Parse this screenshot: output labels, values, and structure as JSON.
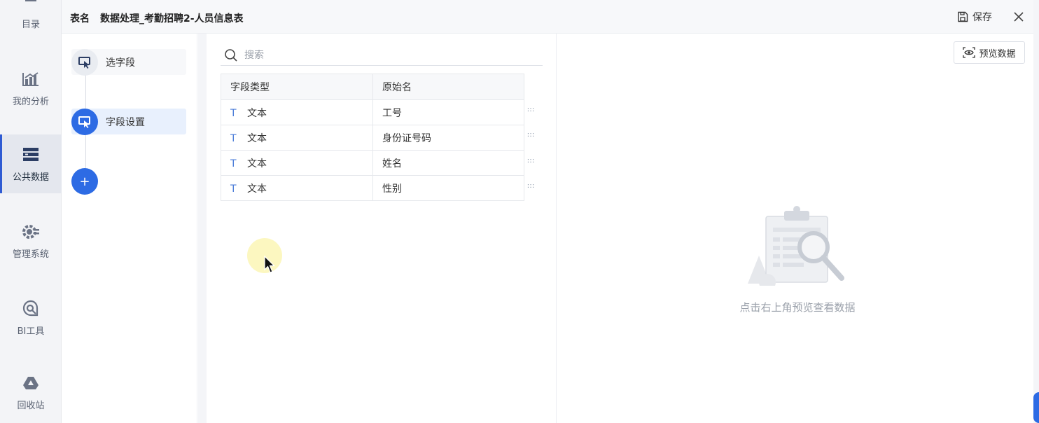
{
  "nav": {
    "items": [
      {
        "label": "目录",
        "icon": "catalog-icon"
      },
      {
        "label": "我的分析",
        "icon": "analysis-icon"
      },
      {
        "label": "公共数据",
        "icon": "public-data-icon",
        "active": true
      },
      {
        "label": "管理系统",
        "icon": "settings-icon"
      },
      {
        "label": "BI工具",
        "icon": "bi-tool-icon"
      },
      {
        "label": "回收站",
        "icon": "recycle-bin-icon"
      }
    ]
  },
  "header": {
    "title_label": "表名",
    "title_name": "数据处理_考勤招聘2-人员信息表",
    "save_label": "保存"
  },
  "steps": {
    "items": [
      {
        "label": "选字段"
      },
      {
        "label": "字段设置",
        "active": true
      }
    ],
    "add_label": "+"
  },
  "fields": {
    "search_placeholder": "搜索",
    "columns": [
      "字段类型",
      "原始名"
    ],
    "rows": [
      {
        "type_icon": "T",
        "type": "文本",
        "name": "工号"
      },
      {
        "type_icon": "T",
        "type": "文本",
        "name": "身份证号码"
      },
      {
        "type_icon": "T",
        "type": "文本",
        "name": "姓名"
      },
      {
        "type_icon": "T",
        "type": "文本",
        "name": "性别"
      }
    ]
  },
  "preview": {
    "button_label": "预览数据",
    "empty_text": "点击右上角预览查看数据"
  },
  "colors": {
    "accent": "#2d6be4",
    "nav_bg": "#f3f4f7",
    "step_active_bg": "#e8f0fd"
  }
}
